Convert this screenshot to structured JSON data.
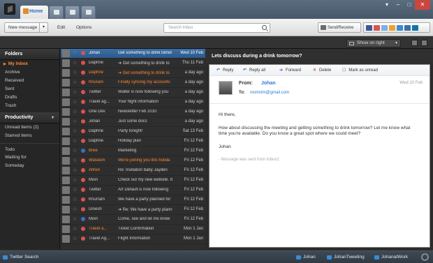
{
  "app": {
    "home_tab": "Home"
  },
  "toolbar": {
    "new_message": "New message",
    "edit": "Edit",
    "options": "Options",
    "search_placeholder": "Search Inbox",
    "send_receive": "Send/Receive"
  },
  "list_toolbar": {
    "show_on": "Show on right"
  },
  "sidebar": {
    "folders_title": "Folders",
    "folders": [
      {
        "label": "My Inbox",
        "active": true
      },
      {
        "label": "Archive"
      },
      {
        "label": "Received"
      },
      {
        "label": "Sent"
      },
      {
        "label": "Drafts"
      },
      {
        "label": "Trash"
      }
    ],
    "productivity_title": "Productivity",
    "productivity": [
      {
        "label": "Unread items  (2)"
      },
      {
        "label": "Starred items"
      }
    ],
    "tasks": [
      {
        "label": "Todo"
      },
      {
        "label": "Waiting for"
      },
      {
        "label": "Someday"
      }
    ],
    "twitter_search": "Twitter Search"
  },
  "messages": [
    {
      "from": "Johan",
      "subject": "Get something to drink tomor",
      "date": "Wed 10 Feb",
      "selected": true,
      "status": "#d9534f"
    },
    {
      "from": "Daphne",
      "subject": "➜ Get something to drink to",
      "date": "Thu 11 Feb",
      "status": "#d9534f"
    },
    {
      "from": "Daphne",
      "subject": "➜ Get something to drink to",
      "date": "a day ago",
      "unread": true,
      "status": "#d9534f"
    },
    {
      "from": "Khuram",
      "subject": "Finally syncing my accounts",
      "date": "a day ago",
      "unread": true,
      "status": "#d9534f"
    },
    {
      "from": "Twitter",
      "subject": "Walter is now following you",
      "date": "a day ago",
      "status": "#d9534f"
    },
    {
      "from": "Travel ag...",
      "subject": "Your flight information",
      "date": "a day ago",
      "status": "#d9534f"
    },
    {
      "from": "One Dev",
      "subject": "Newsletter Feb 2010",
      "date": "a day ago",
      "status": "#d9534f"
    },
    {
      "from": "Johan",
      "subject": "Just some docs",
      "date": "a day ago",
      "status": "#d9534f"
    },
    {
      "from": "Daphne",
      "subject": "Party tonight!",
      "date": "Sat 13 Feb",
      "status": "#d9534f"
    },
    {
      "from": "Daphne",
      "subject": "Holiday plan",
      "date": "Fri 12 Feb",
      "status": "#d9534f"
    },
    {
      "from": "Bree",
      "subject": "Marketing",
      "date": "Fri 12 Feb",
      "unread_from": true,
      "status": "#3b6fc1"
    },
    {
      "from": "Waseem",
      "subject": "We're joining you this holida",
      "date": "Fri 12 Feb",
      "unread": true,
      "status": "#d9534f"
    },
    {
      "from": "Alfred",
      "subject": "Re: Invitation baby Jayden",
      "date": "Fri 12 Feb",
      "unread_from": true,
      "status": "#d9534f"
    },
    {
      "from": "Moin",
      "subject": "Check out my new website. It",
      "date": "Fri 12 Feb",
      "status": "#d9534f"
    },
    {
      "from": "Twitter",
      "subject": "Art Default is now following",
      "date": "Fri 12 Feb",
      "status": "#d9534f"
    },
    {
      "from": "Khurram",
      "subject": "We have a party planned for",
      "date": "Fri 12 Feb",
      "status": "#d9534f"
    },
    {
      "from": "Dinesh",
      "subject": "➜ Re: We have a party plann",
      "date": "Fri 12 Feb",
      "status": "#d9534f"
    },
    {
      "from": "Moin",
      "subject": "Come, see and let me know",
      "date": "Fri 12 Feb",
      "status": "#3b6fc1"
    },
    {
      "from": "Travel a...",
      "subject": "Ticket Confirmation",
      "date": "Mon 1 Jan",
      "unread_from": true,
      "status": "#d9534f"
    },
    {
      "from": "Travel Ag...",
      "subject": "Flight Information",
      "date": "Mon 1 Jan",
      "status": "#d9534f"
    }
  ],
  "reader": {
    "title": "Lets discuss during a drink tomorrow?",
    "actions": {
      "reply": "Reply",
      "reply_all": "Reply all",
      "forward": "Forward",
      "delete": "Delete",
      "mark_unread": "Mark as unread"
    },
    "from_label": "From:",
    "from": "Johan",
    "to_label": "To:",
    "to": "moinvtm@gmail.com",
    "date": "Wed 10 Feb",
    "greeting": "Hi there,",
    "body": "How about discussing the meeting and getting something to drink tomorrow? Let me know what time you're available. Do you know a great spot where we could meet?",
    "signature": "Johan",
    "footer": "- Message was sent from Inbox2"
  },
  "statusbar": {
    "accounts": [
      "Johan",
      "JohanTweeting",
      "JohanatWork"
    ]
  },
  "colors": {
    "accent": "#ff8a33",
    "selection": "#3d6fa5",
    "link": "#2a7ad0"
  }
}
